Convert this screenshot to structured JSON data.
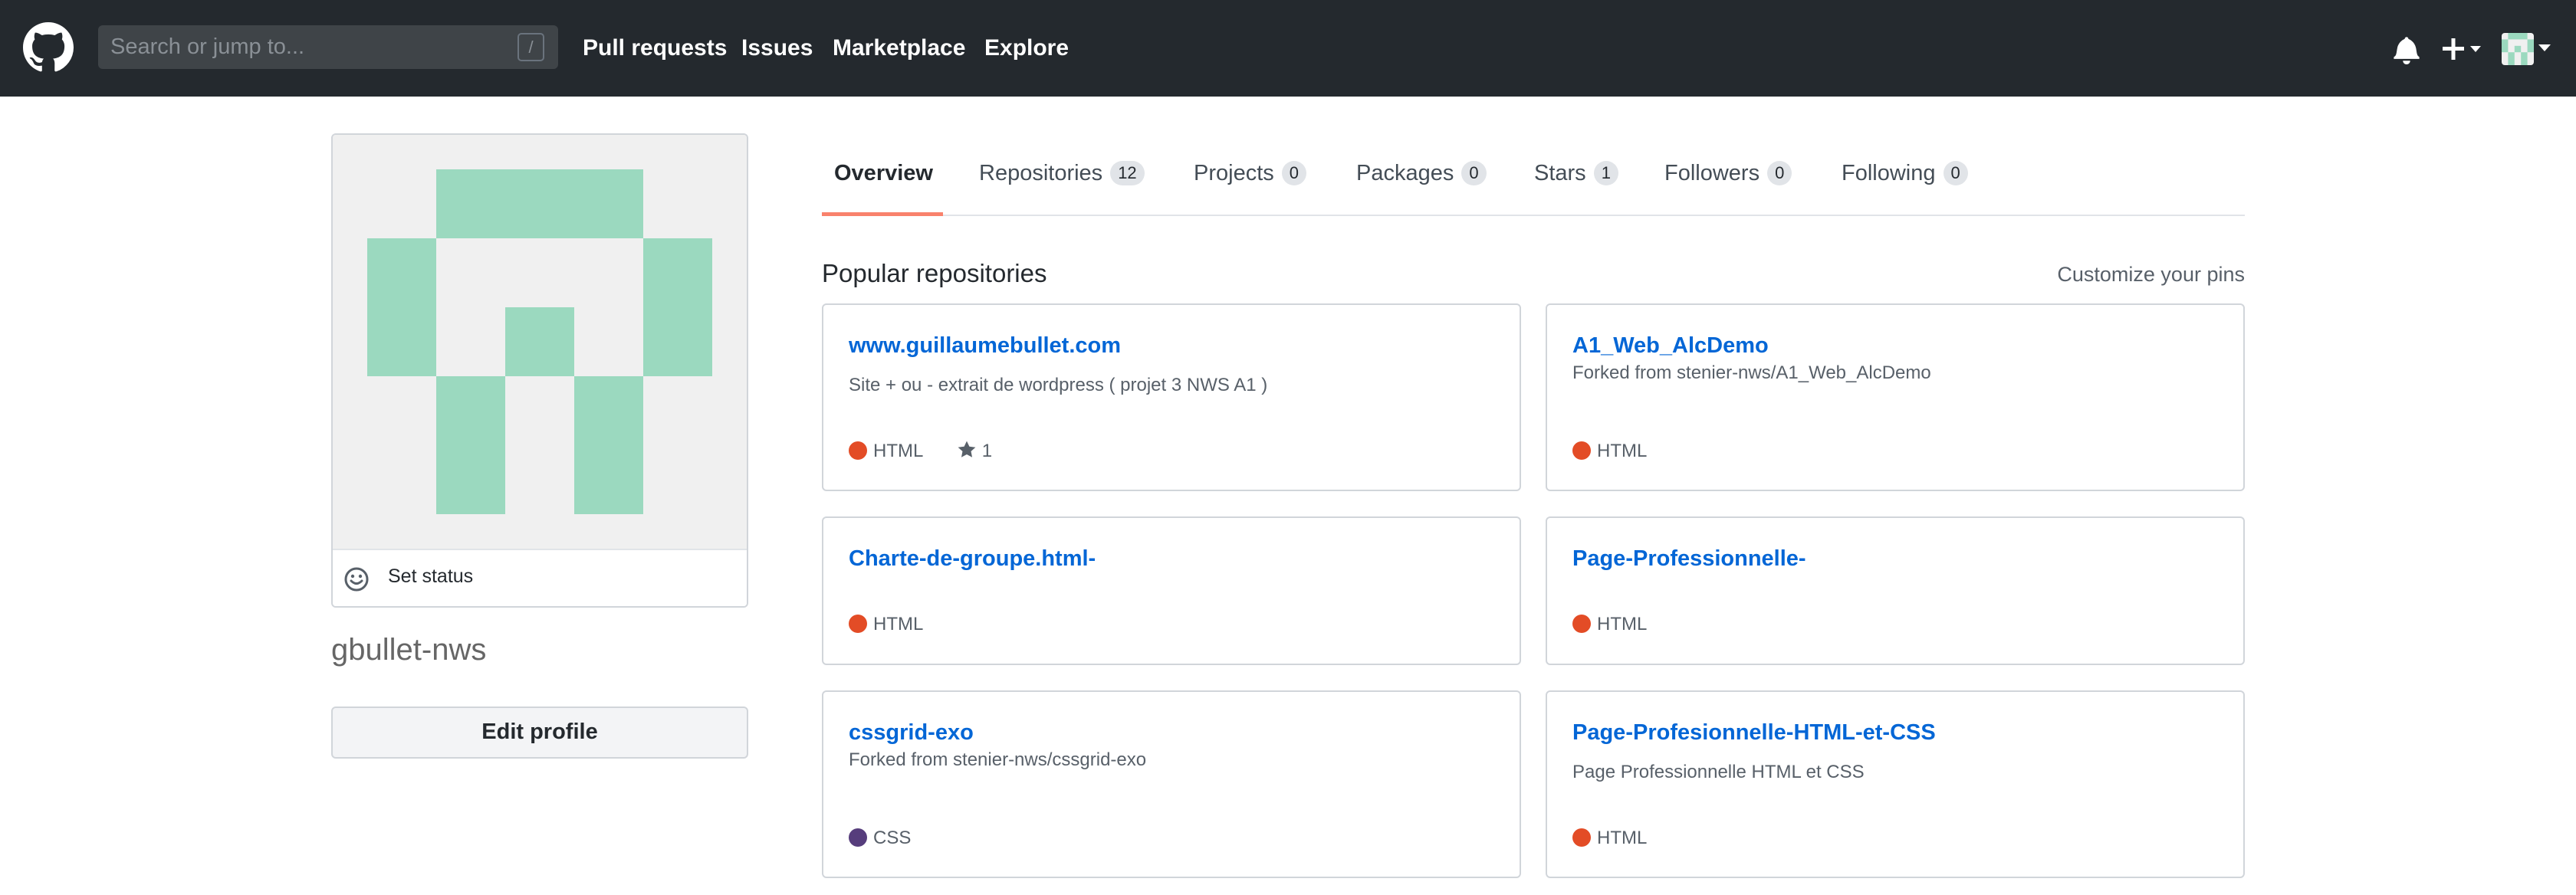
{
  "header": {
    "search_placeholder": "Search or jump to...",
    "search_shortcut": "/",
    "nav": [
      "Pull requests",
      "Issues",
      "Marketplace",
      "Explore"
    ]
  },
  "profile": {
    "set_status": "Set status",
    "username": "gbullet-nws",
    "edit_profile": "Edit profile",
    "avatar_color": "#9bd9bf"
  },
  "tabs": [
    {
      "label": "Overview",
      "count": ""
    },
    {
      "label": "Repositories",
      "count": "12"
    },
    {
      "label": "Projects",
      "count": "0"
    },
    {
      "label": "Packages",
      "count": "0"
    },
    {
      "label": "Stars",
      "count": "1"
    },
    {
      "label": "Followers",
      "count": "0"
    },
    {
      "label": "Following",
      "count": "0"
    }
  ],
  "popular": {
    "title": "Popular repositories",
    "customize": "Customize your pins"
  },
  "repos": [
    {
      "name": "www.guillaumebullet.com",
      "desc": "Site + ou - extrait de wordpress ( projet 3 NWS A1 )",
      "lang": "HTML",
      "lang_color": "#e34c26",
      "stars": "1"
    },
    {
      "name": "A1_Web_AlcDemo",
      "desc": "Forked from stenier-nws/A1_Web_AlcDemo",
      "lang": "HTML",
      "lang_color": "#e34c26",
      "stars": ""
    },
    {
      "name": "Charte-de-groupe.html-",
      "desc": "",
      "lang": "HTML",
      "lang_color": "#e34c26",
      "stars": ""
    },
    {
      "name": "Page-Professionnelle-",
      "desc": "",
      "lang": "HTML",
      "lang_color": "#e34c26",
      "stars": ""
    },
    {
      "name": "cssgrid-exo",
      "desc": "Forked from stenier-nws/cssgrid-exo",
      "lang": "CSS",
      "lang_color": "#563d7c",
      "stars": ""
    },
    {
      "name": "Page-Profesionnelle-HTML-et-CSS",
      "desc": "Page Professionnelle HTML et CSS",
      "lang": "HTML",
      "lang_color": "#e34c26",
      "stars": ""
    }
  ]
}
